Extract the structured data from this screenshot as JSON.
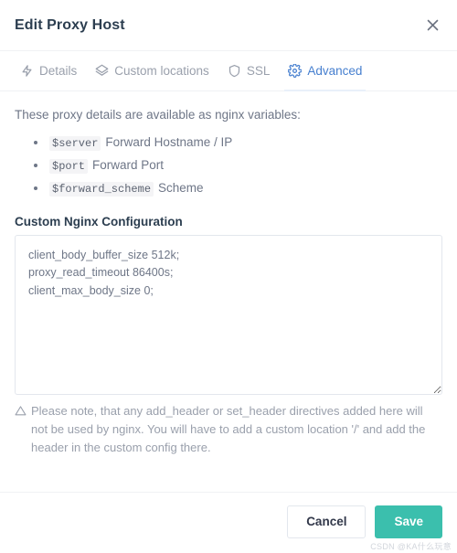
{
  "header": {
    "title": "Edit Proxy Host",
    "close_icon": "close-icon"
  },
  "tabs": [
    {
      "label": "Details",
      "icon": "bolt-icon",
      "active": false
    },
    {
      "label": "Custom locations",
      "icon": "layers-icon",
      "active": false
    },
    {
      "label": "SSL",
      "icon": "shield-icon",
      "active": false
    },
    {
      "label": "Advanced",
      "icon": "gear-icon",
      "active": true
    }
  ],
  "body": {
    "intro": "These proxy details are available as nginx variables:",
    "variables": [
      {
        "name": "$server",
        "description": "Forward Hostname / IP"
      },
      {
        "name": "$port",
        "description": "Forward Port"
      },
      {
        "name": "$forward_scheme",
        "description": "Scheme"
      }
    ],
    "config": {
      "label": "Custom Nginx Configuration",
      "value": "client_body_buffer_size 512k;\nproxy_read_timeout 86400s;\nclient_max_body_size 0;",
      "placeholder": ""
    },
    "note": {
      "icon": "warning-triangle-icon",
      "text": "Please note, that any add_header or set_header directives added here will not be used by nginx. You will have to add a custom location '/' and add the header in the custom config there."
    }
  },
  "footer": {
    "cancel_label": "Cancel",
    "save_label": "Save",
    "watermark": "CSDN @KA什么玩意"
  },
  "colors": {
    "accent_blue": "#467fcf",
    "save_teal": "#3bbfad",
    "muted_text": "#9aa0ac",
    "body_text": "#6e7687",
    "title_text": "#2c3e50",
    "border": "#e3e7ed"
  }
}
